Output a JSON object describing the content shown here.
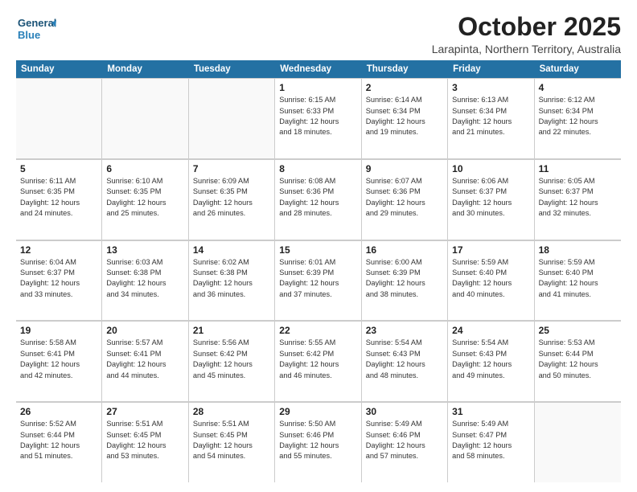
{
  "logo": {
    "general": "General",
    "blue": "Blue"
  },
  "header": {
    "month": "October 2025",
    "location": "Larapinta, Northern Territory, Australia"
  },
  "days": [
    "Sunday",
    "Monday",
    "Tuesday",
    "Wednesday",
    "Thursday",
    "Friday",
    "Saturday"
  ],
  "weeks": [
    [
      {
        "day": "",
        "text": ""
      },
      {
        "day": "",
        "text": ""
      },
      {
        "day": "",
        "text": ""
      },
      {
        "day": "1",
        "text": "Sunrise: 6:15 AM\nSunset: 6:33 PM\nDaylight: 12 hours\nand 18 minutes."
      },
      {
        "day": "2",
        "text": "Sunrise: 6:14 AM\nSunset: 6:34 PM\nDaylight: 12 hours\nand 19 minutes."
      },
      {
        "day": "3",
        "text": "Sunrise: 6:13 AM\nSunset: 6:34 PM\nDaylight: 12 hours\nand 21 minutes."
      },
      {
        "day": "4",
        "text": "Sunrise: 6:12 AM\nSunset: 6:34 PM\nDaylight: 12 hours\nand 22 minutes."
      }
    ],
    [
      {
        "day": "5",
        "text": "Sunrise: 6:11 AM\nSunset: 6:35 PM\nDaylight: 12 hours\nand 24 minutes."
      },
      {
        "day": "6",
        "text": "Sunrise: 6:10 AM\nSunset: 6:35 PM\nDaylight: 12 hours\nand 25 minutes."
      },
      {
        "day": "7",
        "text": "Sunrise: 6:09 AM\nSunset: 6:35 PM\nDaylight: 12 hours\nand 26 minutes."
      },
      {
        "day": "8",
        "text": "Sunrise: 6:08 AM\nSunset: 6:36 PM\nDaylight: 12 hours\nand 28 minutes."
      },
      {
        "day": "9",
        "text": "Sunrise: 6:07 AM\nSunset: 6:36 PM\nDaylight: 12 hours\nand 29 minutes."
      },
      {
        "day": "10",
        "text": "Sunrise: 6:06 AM\nSunset: 6:37 PM\nDaylight: 12 hours\nand 30 minutes."
      },
      {
        "day": "11",
        "text": "Sunrise: 6:05 AM\nSunset: 6:37 PM\nDaylight: 12 hours\nand 32 minutes."
      }
    ],
    [
      {
        "day": "12",
        "text": "Sunrise: 6:04 AM\nSunset: 6:37 PM\nDaylight: 12 hours\nand 33 minutes."
      },
      {
        "day": "13",
        "text": "Sunrise: 6:03 AM\nSunset: 6:38 PM\nDaylight: 12 hours\nand 34 minutes."
      },
      {
        "day": "14",
        "text": "Sunrise: 6:02 AM\nSunset: 6:38 PM\nDaylight: 12 hours\nand 36 minutes."
      },
      {
        "day": "15",
        "text": "Sunrise: 6:01 AM\nSunset: 6:39 PM\nDaylight: 12 hours\nand 37 minutes."
      },
      {
        "day": "16",
        "text": "Sunrise: 6:00 AM\nSunset: 6:39 PM\nDaylight: 12 hours\nand 38 minutes."
      },
      {
        "day": "17",
        "text": "Sunrise: 5:59 AM\nSunset: 6:40 PM\nDaylight: 12 hours\nand 40 minutes."
      },
      {
        "day": "18",
        "text": "Sunrise: 5:59 AM\nSunset: 6:40 PM\nDaylight: 12 hours\nand 41 minutes."
      }
    ],
    [
      {
        "day": "19",
        "text": "Sunrise: 5:58 AM\nSunset: 6:41 PM\nDaylight: 12 hours\nand 42 minutes."
      },
      {
        "day": "20",
        "text": "Sunrise: 5:57 AM\nSunset: 6:41 PM\nDaylight: 12 hours\nand 44 minutes."
      },
      {
        "day": "21",
        "text": "Sunrise: 5:56 AM\nSunset: 6:42 PM\nDaylight: 12 hours\nand 45 minutes."
      },
      {
        "day": "22",
        "text": "Sunrise: 5:55 AM\nSunset: 6:42 PM\nDaylight: 12 hours\nand 46 minutes."
      },
      {
        "day": "23",
        "text": "Sunrise: 5:54 AM\nSunset: 6:43 PM\nDaylight: 12 hours\nand 48 minutes."
      },
      {
        "day": "24",
        "text": "Sunrise: 5:54 AM\nSunset: 6:43 PM\nDaylight: 12 hours\nand 49 minutes."
      },
      {
        "day": "25",
        "text": "Sunrise: 5:53 AM\nSunset: 6:44 PM\nDaylight: 12 hours\nand 50 minutes."
      }
    ],
    [
      {
        "day": "26",
        "text": "Sunrise: 5:52 AM\nSunset: 6:44 PM\nDaylight: 12 hours\nand 51 minutes."
      },
      {
        "day": "27",
        "text": "Sunrise: 5:51 AM\nSunset: 6:45 PM\nDaylight: 12 hours\nand 53 minutes."
      },
      {
        "day": "28",
        "text": "Sunrise: 5:51 AM\nSunset: 6:45 PM\nDaylight: 12 hours\nand 54 minutes."
      },
      {
        "day": "29",
        "text": "Sunrise: 5:50 AM\nSunset: 6:46 PM\nDaylight: 12 hours\nand 55 minutes."
      },
      {
        "day": "30",
        "text": "Sunrise: 5:49 AM\nSunset: 6:46 PM\nDaylight: 12 hours\nand 57 minutes."
      },
      {
        "day": "31",
        "text": "Sunrise: 5:49 AM\nSunset: 6:47 PM\nDaylight: 12 hours\nand 58 minutes."
      },
      {
        "day": "",
        "text": ""
      }
    ]
  ]
}
